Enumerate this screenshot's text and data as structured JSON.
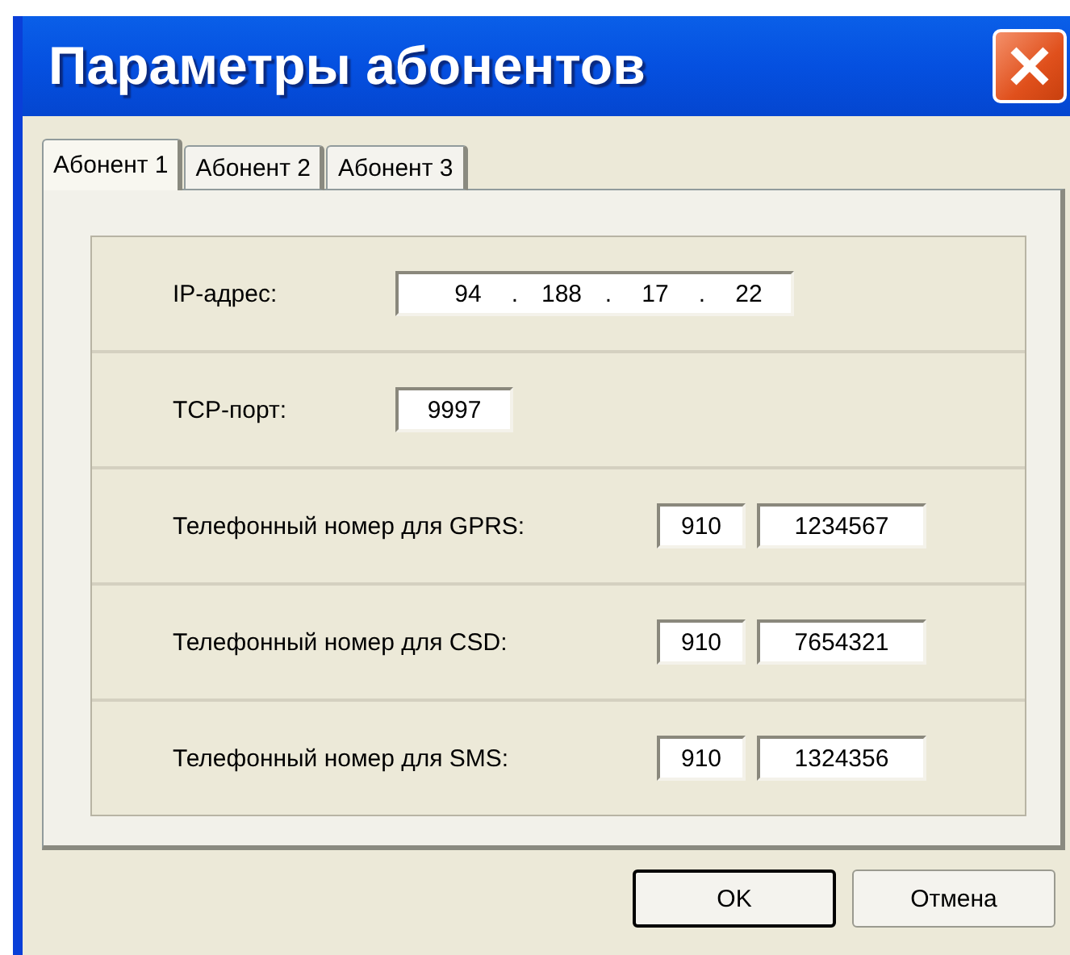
{
  "window": {
    "title": "Параметры абонентов"
  },
  "tabs": [
    {
      "label": "Абонент 1",
      "selected": true
    },
    {
      "label": "Абонент 2",
      "selected": false
    },
    {
      "label": "Абонент 3",
      "selected": false
    }
  ],
  "rows": [
    {
      "kind": "ip",
      "label": "IP-адрес:",
      "octets": [
        "94",
        "188",
        "17",
        "22"
      ],
      "separator": "."
    },
    {
      "kind": "port",
      "label": "TCP-порт:",
      "value": "9997"
    },
    {
      "kind": "phone",
      "label": "Телефонный номер для GPRS:",
      "code": "910",
      "number": "1234567"
    },
    {
      "kind": "phone",
      "label": "Телефонный номер для CSD:",
      "code": "910",
      "number": "7654321"
    },
    {
      "kind": "phone",
      "label": "Телефонный номер для SMS:",
      "code": "910",
      "number": "1324356"
    }
  ],
  "buttons": [
    {
      "label": "OK",
      "default": true
    },
    {
      "label": "Отмена",
      "default": false
    }
  ]
}
